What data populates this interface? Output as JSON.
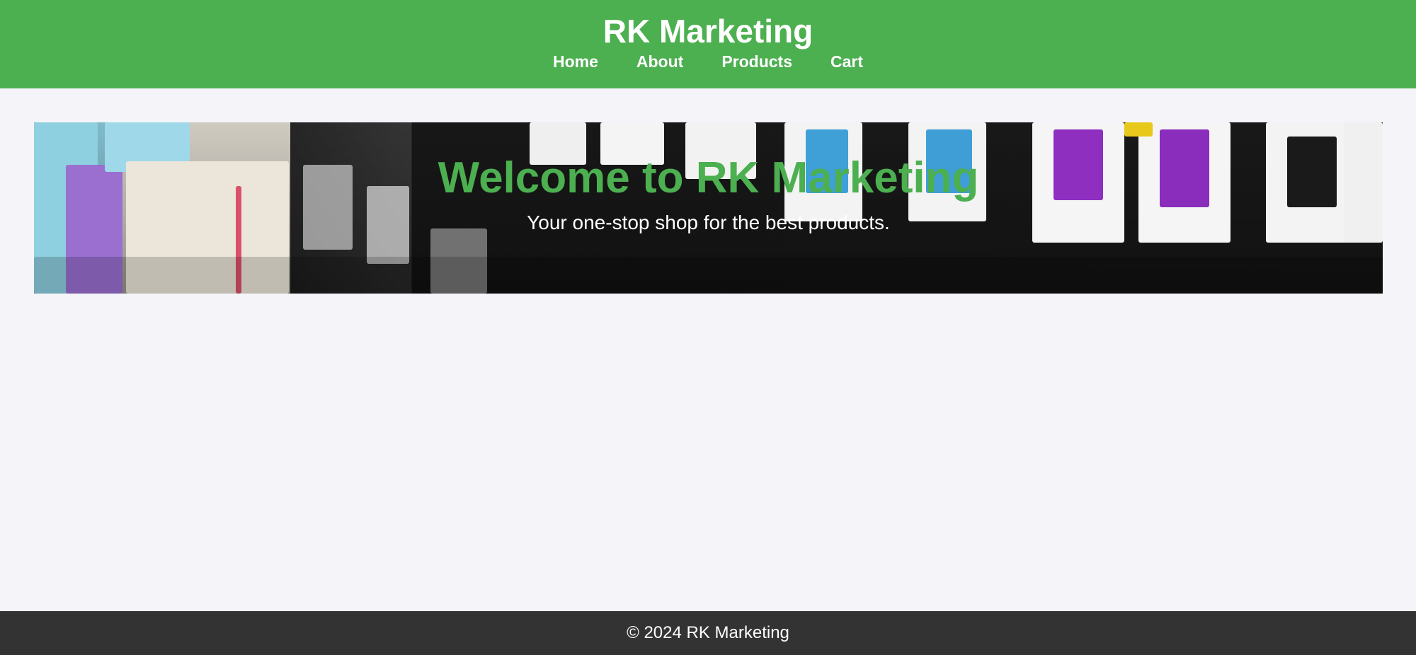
{
  "header": {
    "title": "RK Marketing",
    "nav": [
      {
        "label": "Home"
      },
      {
        "label": "About"
      },
      {
        "label": "Products"
      },
      {
        "label": "Cart"
      }
    ]
  },
  "hero": {
    "title": "Welcome to RK Marketing",
    "subtitle": "Your one-stop shop for the best products."
  },
  "footer": {
    "text": "© 2024 RK Marketing"
  },
  "colors": {
    "header_bg": "#4caf50",
    "accent": "#4caf50",
    "page_bg": "#f4f4f9",
    "footer_bg": "#333333",
    "text_light": "#ffffff"
  }
}
